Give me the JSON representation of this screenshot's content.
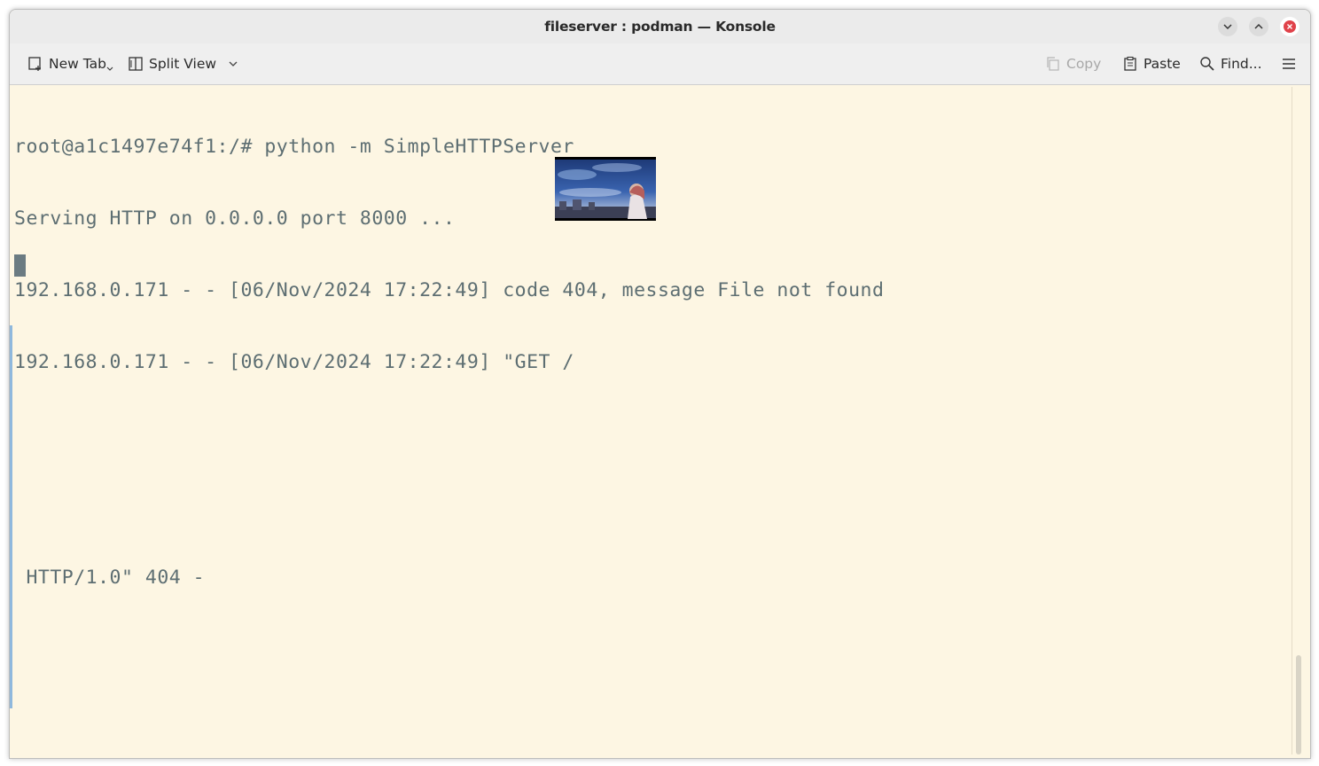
{
  "window": {
    "title": "fileserver : podman — Konsole"
  },
  "window_controls": {
    "minimize_icon": "chevron-down-icon",
    "maximize_icon": "chevron-up-icon",
    "close_icon": "close-icon",
    "close_color": "#e0424a"
  },
  "toolbar": {
    "new_tab_label": "New Tab",
    "split_view_label": "Split View",
    "copy_label": "Copy",
    "paste_label": "Paste",
    "find_label": "Find..."
  },
  "terminal": {
    "lines": [
      "root@a1c1497e74f1:/# python -m SimpleHTTPServer",
      "Serving HTTP on 0.0.0.0 port 8000 ...",
      "192.168.0.171 - - [06/Nov/2024 17:22:49] code 404, message File not found",
      "192.168.0.171 - - [06/Nov/2024 17:22:49] \"GET /",
      "",
      "",
      " HTTP/1.0\" 404 -"
    ],
    "background": "#fdf6e3",
    "foreground": "#5d6e72"
  }
}
